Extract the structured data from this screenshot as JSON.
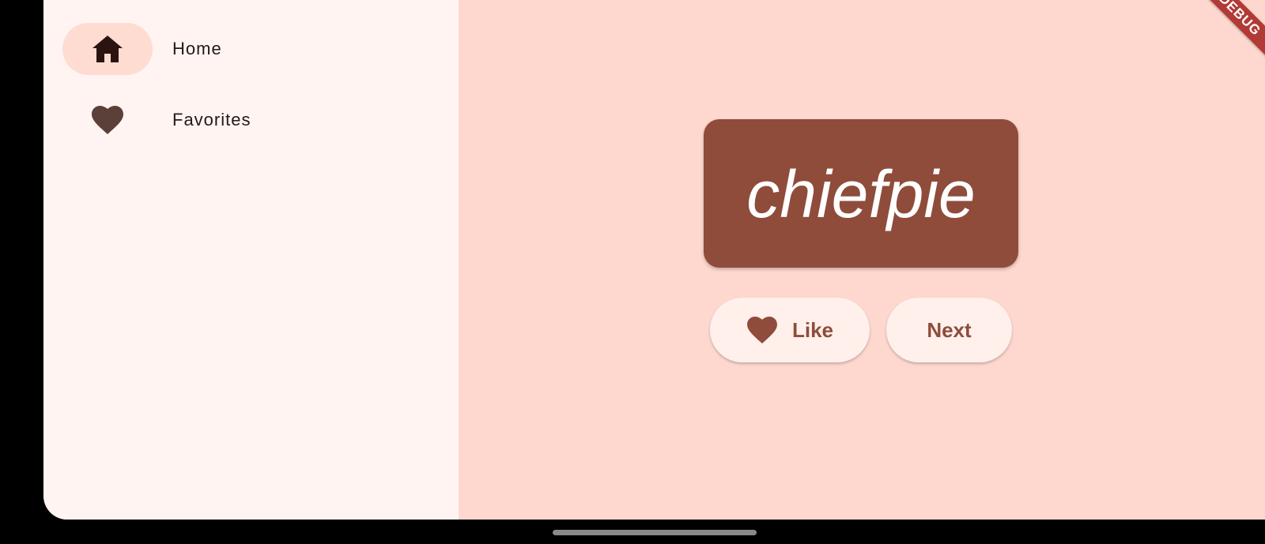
{
  "nav": {
    "items": [
      {
        "label": "Home",
        "icon": "home-icon",
        "selected": true
      },
      {
        "label": "Favorites",
        "icon": "heart-icon",
        "selected": false
      }
    ]
  },
  "main": {
    "word": "chiefpie",
    "like_label": "Like",
    "like_icon": "heart-icon",
    "next_label": "Next"
  },
  "debug_banner": "DEBUG",
  "colors": {
    "primary": "#8f4c3b",
    "background": "#fed8cf",
    "nav_background": "#fff4f2",
    "nav_indicator": "#ffdcd2",
    "button_background": "#fff0ec",
    "debug_banner": "#b23a36"
  }
}
